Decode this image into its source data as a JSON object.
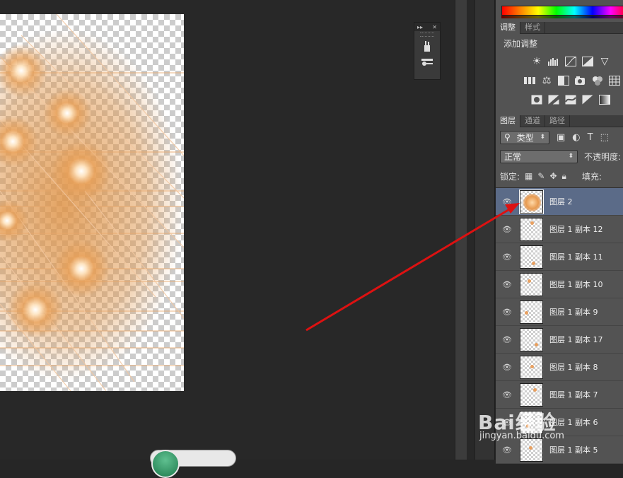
{
  "adjustments_panel": {
    "tabs": [
      "调整",
      "样式"
    ],
    "active_tab": 0,
    "title": "添加调整"
  },
  "layers_panel": {
    "tabs": [
      "图层",
      "通道",
      "路径"
    ],
    "active_tab": 0,
    "filter_label": "类型",
    "blend_mode": "正常",
    "opacity_label": "不透明度:",
    "lock_label": "锁定:",
    "fill_label": "填充:",
    "layers": [
      {
        "name": "图层 2",
        "selected": true
      },
      {
        "name": "图层 1 副本 12",
        "selected": false
      },
      {
        "name": "图层 1 副本 11",
        "selected": false
      },
      {
        "name": "图层 1 副本 10",
        "selected": false
      },
      {
        "name": "图层 1 副本 9",
        "selected": false
      },
      {
        "name": "图层 1 副本 17",
        "selected": false
      },
      {
        "name": "图层 1 副本 8",
        "selected": false
      },
      {
        "name": "图层 1 副本 7",
        "selected": false
      },
      {
        "name": "图层 1 副本 6",
        "selected": false
      },
      {
        "name": "图层 1 副本 5",
        "selected": false
      }
    ]
  },
  "watermark": {
    "text": "Bai经验",
    "sub": "jingyan.baidu.com"
  },
  "colors": {
    "arrow": "#dd1111",
    "selected_layer": "#5b6b88",
    "panel_bg": "#535353",
    "canvas_bg": "#282828"
  }
}
